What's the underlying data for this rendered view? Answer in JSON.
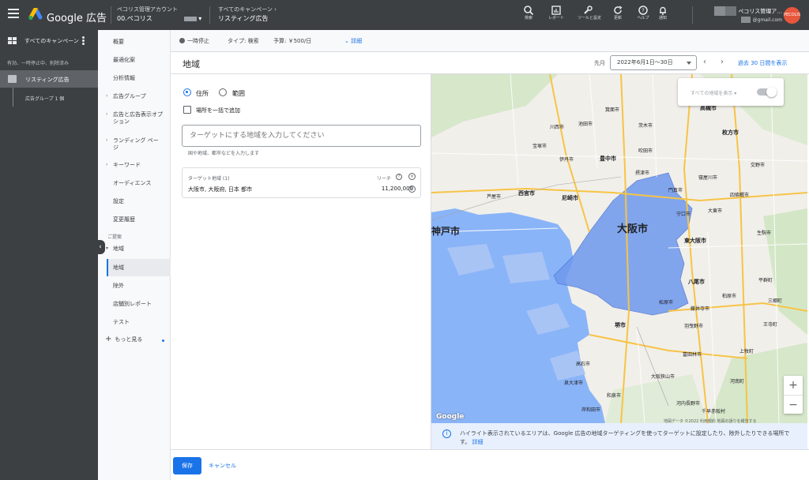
{
  "app": {
    "brand": "Google 広告"
  },
  "account": {
    "label": "ペコリス管理アカウント",
    "name": "00.ペコリス"
  },
  "breadcrumb": {
    "label": "すべてのキャンペーン",
    "name": "リスティング広告"
  },
  "toolbar": {
    "search": "検索",
    "report": "レポート",
    "tools": "ツールと設定",
    "refresh": "更新",
    "help": "ヘルプ",
    "notify": "通知"
  },
  "user": {
    "name": "ペコリス管理ア...",
    "email": "@gmail.com",
    "avatar": "PECOLIS"
  },
  "nav": {
    "all_campaigns": "すべてのキャンペーン",
    "filter": "有効、一時停止中、削除済み",
    "campaign": "リスティング広告",
    "adgroup": "広告グループ 1 個"
  },
  "subnav": {
    "items": [
      "概要",
      "最適化案",
      "分析情報",
      "広告グループ",
      "広告と広告表示オプション",
      "ランディング ページ",
      "キーワード",
      "オーディエンス",
      "設定",
      "変更履歴"
    ],
    "section": "ご提案",
    "area_parent": "地域",
    "area_items": [
      "地域",
      "除外",
      "店舗別レポート",
      "テスト"
    ],
    "more": "もっと見る"
  },
  "status": {
    "paused": "一時停止",
    "type": "タイプ: 検索",
    "budget": "予算: ￥500/日",
    "details": "詳細"
  },
  "page": {
    "title": "地域",
    "prev_month": "先月",
    "date_range": "2022年6月1日〜30日",
    "last30": "過去 30 日間を表示"
  },
  "form": {
    "radio_address": "住所",
    "radio_range": "範囲",
    "bulk_add": "場所を一括で追加",
    "search_placeholder": "ターゲットにする地域を入力してください",
    "hint": "国や地域、都市などを入力します",
    "target_header": "ターゲット地域 (1)",
    "reach_header": "リーチ",
    "target_location": "大阪市, 大阪府, 日本 都市",
    "target_reach": "11,200,000"
  },
  "map": {
    "toggle_label": "すべての地域を表示",
    "city_osaka": "大阪市",
    "labels": [
      "豊中市",
      "西宮市",
      "尼崎市",
      "東大阪市",
      "八尾市",
      "堺市",
      "枚方市",
      "高槻市",
      "門真市",
      "生駒市",
      "大阪狭山市",
      "泉大津市",
      "岸和田市",
      "和泉市",
      "富田林市",
      "羽曳野市",
      "伊丹市",
      "宝塚市",
      "千早赤阪村",
      "河南町",
      "高石市",
      "茨木市",
      "摂津市",
      "寝屋川市",
      "交野市",
      "藤井寺市",
      "平群町",
      "三郷町",
      "王寺町",
      "上牧町",
      "芦屋市",
      "吹田市",
      "松原市",
      "柏原市",
      "河内長野市",
      "箕面市",
      "池田市",
      "川西市",
      "守口市",
      "大東市",
      "四條畷市",
      "神戸市"
    ],
    "attribution": "地図データ ©2022 利用規約 地図の誤りを報告する",
    "google": "Google",
    "info": "ハイライト表示されているエリアは、Google 広告の地域ターゲティングを使ってターゲットに設定したり、除外したりできる場所です。",
    "info_link": "詳細"
  },
  "footer": {
    "save": "保存",
    "cancel": "キャンセル"
  }
}
